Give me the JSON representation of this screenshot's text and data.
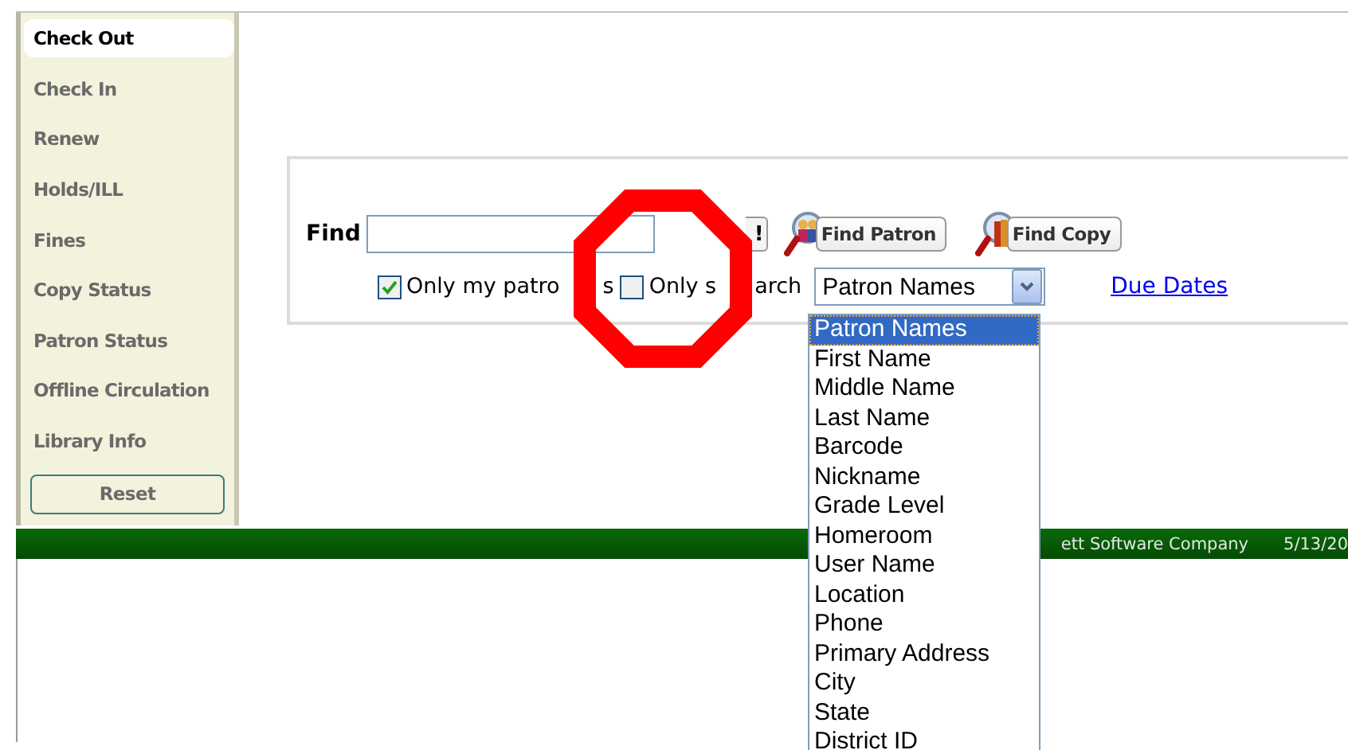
{
  "sidebar": {
    "items": [
      {
        "label": "Check Out",
        "selected": true
      },
      {
        "label": "Check In",
        "selected": false
      },
      {
        "label": "Renew",
        "selected": false
      },
      {
        "label": "Holds/ILL",
        "selected": false
      },
      {
        "label": "Fines",
        "selected": false
      },
      {
        "label": "Copy Status",
        "selected": false
      },
      {
        "label": "Patron Status",
        "selected": false
      },
      {
        "label": "Offline Circulation",
        "selected": false
      },
      {
        "label": "Library Info",
        "selected": false
      }
    ],
    "reset_button": "Reset"
  },
  "find_panel": {
    "find_label": "Find",
    "go_button": "!",
    "find_patron_button": "Find Patron",
    "find_copy_button": "Find Copy",
    "checkboxes": [
      {
        "label": "Only my patro",
        "label_tail": "s",
        "checked": true
      },
      {
        "label": "Only s",
        "label_tail": "arch",
        "checked": false
      }
    ],
    "search_field_select": {
      "value": "Patron Names",
      "expanded": true,
      "options": [
        {
          "label": "Patron Names",
          "selected": true
        },
        {
          "label": "First Name",
          "selected": false
        },
        {
          "label": "Middle Name",
          "selected": false
        },
        {
          "label": "Last Name",
          "selected": false
        },
        {
          "label": "Barcode",
          "selected": false
        },
        {
          "label": "Nickname",
          "selected": false
        },
        {
          "label": "Grade Level",
          "selected": false
        },
        {
          "label": "Homeroom",
          "selected": false
        },
        {
          "label": "User Name",
          "selected": false
        },
        {
          "label": "Location",
          "selected": false
        },
        {
          "label": "Phone",
          "selected": false
        },
        {
          "label": "Primary Address",
          "selected": false
        },
        {
          "label": "City",
          "selected": false
        },
        {
          "label": "State",
          "selected": false
        },
        {
          "label": "District ID",
          "selected": false
        }
      ]
    },
    "due_dates_link": "Due Dates"
  },
  "status_bar": {
    "company": "ett Software Company",
    "date": "5/13/20"
  }
}
